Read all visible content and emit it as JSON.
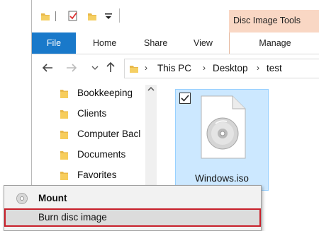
{
  "context_tab_header": "Disc Image Tools",
  "ribbon": {
    "tabs": [
      "File",
      "Home",
      "Share",
      "View"
    ],
    "manage": "Manage"
  },
  "address": {
    "crumbs": [
      "This PC",
      "Desktop",
      "test"
    ]
  },
  "nav_tree": {
    "items": [
      "Bookkeeping",
      "Clients",
      "Computer Bacl",
      "Documents",
      "Favorites"
    ]
  },
  "file": {
    "name": "Windows.iso"
  },
  "context_menu": {
    "items": [
      "Mount",
      "Burn disc image"
    ]
  },
  "colors": {
    "file_tab": "#1979ca",
    "context_header": "#f9d7c4",
    "selection": "#cce8ff",
    "highlight_border": "#c8202a"
  }
}
